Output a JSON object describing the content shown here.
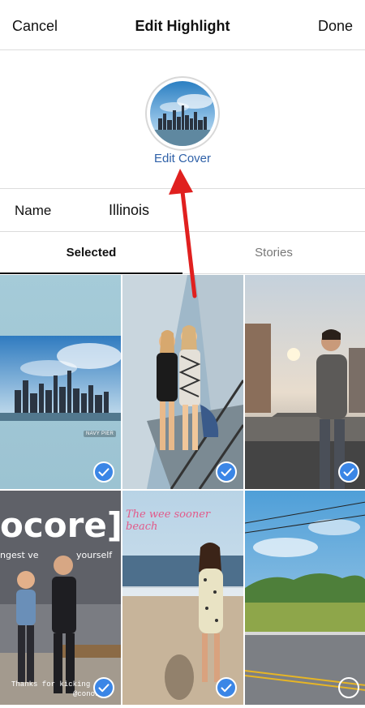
{
  "header": {
    "cancel_label": "Cancel",
    "title": "Edit Highlight",
    "done_label": "Done"
  },
  "cover": {
    "edit_cover_label": "Edit Cover"
  },
  "name_field": {
    "label": "Name",
    "value": "Illinois"
  },
  "tabs": {
    "selected_label": "Selected",
    "stories_label": "Stories"
  },
  "grid": {
    "items": [
      {
        "tag": "NAVY PIER",
        "checked": true
      },
      {
        "tag": "",
        "checked": true
      },
      {
        "tag": "",
        "checked": true
      },
      {
        "big_text": "ocore]",
        "line2": "ngest ve",
        "line3": "yourself",
        "caption1": "Thanks for kicking",
        "caption2": "@conor",
        "checked": true
      },
      {
        "script": "The wee sooner beach",
        "checked": true
      },
      {
        "checked": false
      }
    ]
  },
  "colors": {
    "accent": "#3b86e6",
    "link": "#2f61a8",
    "arrow": "#e0201f"
  }
}
